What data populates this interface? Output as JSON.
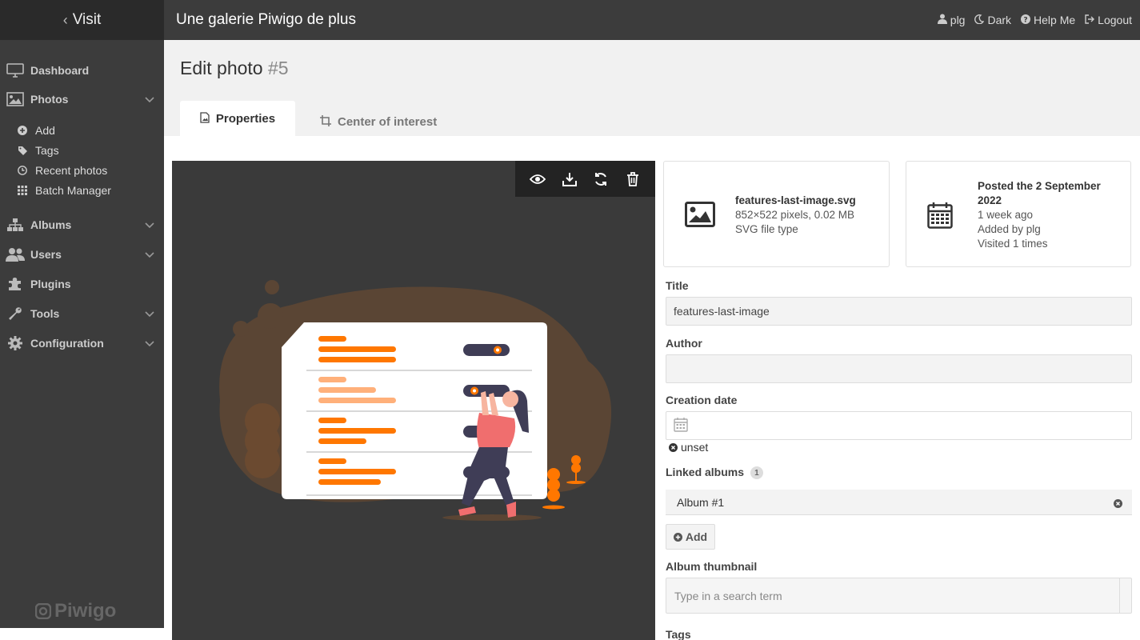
{
  "topbar": {
    "visit_label": "Visit",
    "gallery_title": "Une galerie Piwigo de plus",
    "user_label": "plg",
    "dark_label": "Dark",
    "help_label": "Help Me",
    "logout_label": "Logout"
  },
  "sidebar": {
    "dashboard": "Dashboard",
    "photos": "Photos",
    "photos_sub": {
      "add": "Add",
      "tags": "Tags",
      "recent": "Recent photos",
      "batch": "Batch Manager"
    },
    "albums": "Albums",
    "users": "Users",
    "plugins": "Plugins",
    "tools": "Tools",
    "configuration": "Configuration",
    "logo_text": "Piwigo"
  },
  "page": {
    "title": "Edit photo",
    "photo_number": "#5"
  },
  "tabs": {
    "properties": "Properties",
    "center_of_interest": "Center of interest"
  },
  "file_card": {
    "filename": "features-last-image.svg",
    "dimensions": "852×522 pixels, 0.02 MB",
    "file_type": "SVG file type"
  },
  "date_card": {
    "posted": "Posted the 2 September 2022",
    "ago": "1 week ago",
    "added_by": "Added by plg",
    "visited": "Visited 1 times"
  },
  "form": {
    "title_label": "Title",
    "title_value": "features-last-image",
    "author_label": "Author",
    "author_value": "",
    "creation_date_label": "Creation date",
    "unset_label": "unset",
    "linked_albums_label": "Linked albums",
    "linked_albums_count": "1",
    "album_name": "Album #1",
    "add_label": "Add",
    "album_thumbnail_label": "Album thumbnail",
    "search_placeholder": "Type in a search term",
    "tags_label": "Tags"
  },
  "colors": {
    "topbar": "#3c3c3c",
    "sidebar": "#3c3c3c",
    "accent_orange": "#ff7700",
    "image_bg": "#3a3a3a"
  }
}
